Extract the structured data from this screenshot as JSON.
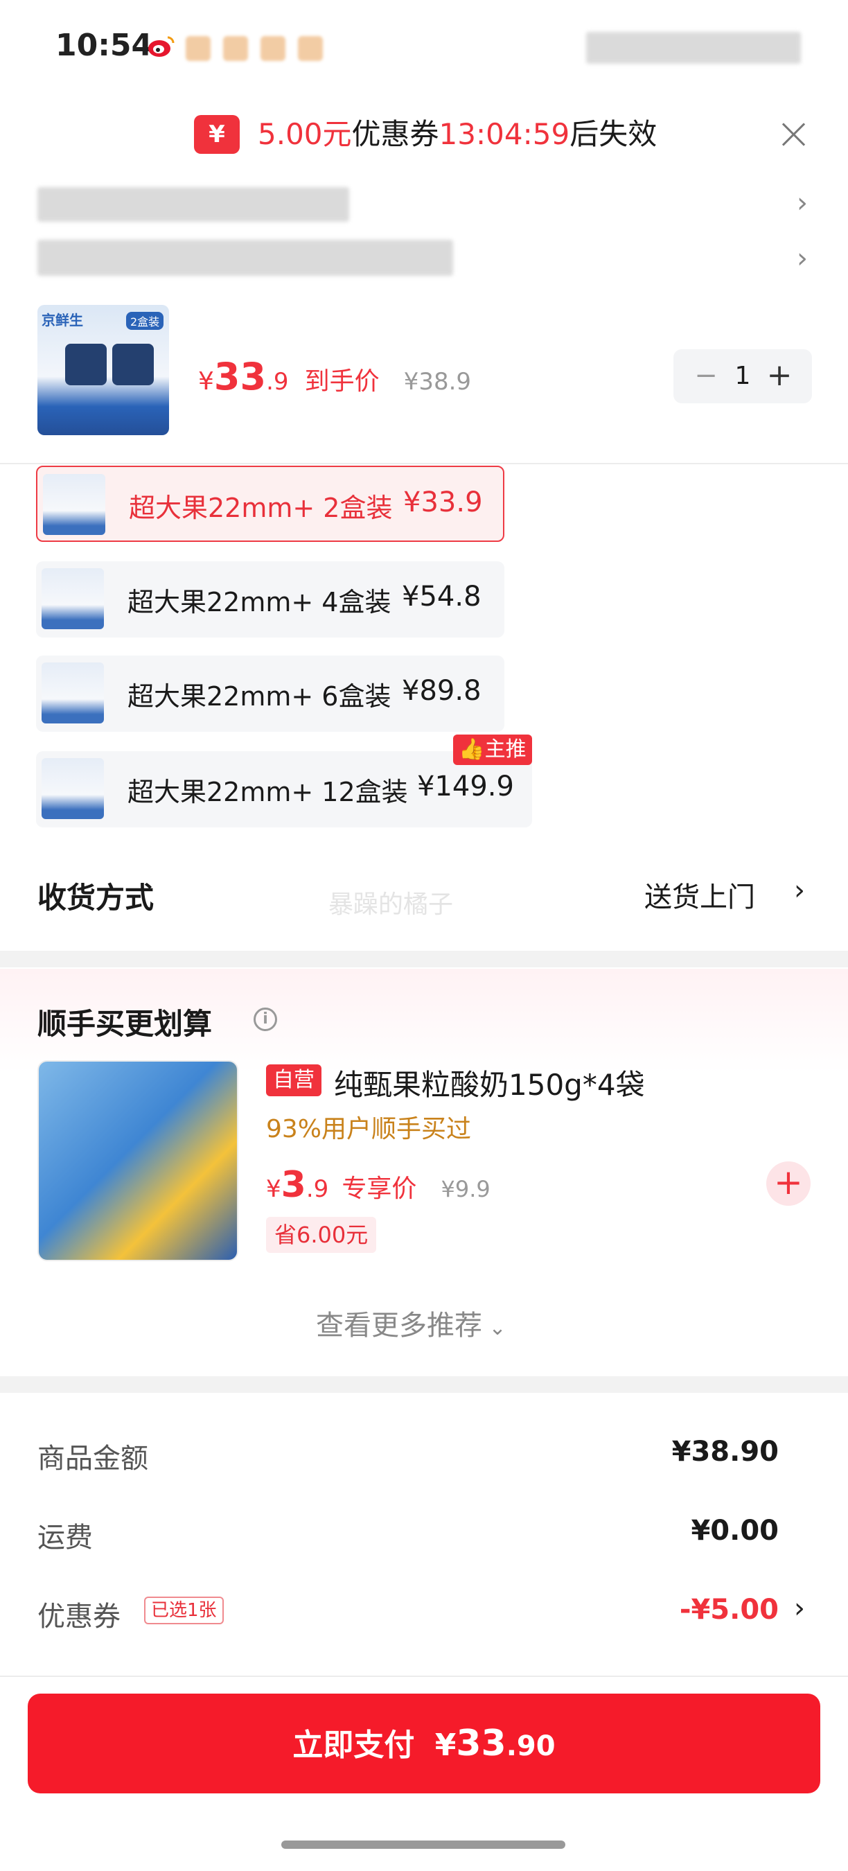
{
  "status_bar": {
    "time": "10:54"
  },
  "coupon_banner": {
    "icon": "¥",
    "amount": "5.00元",
    "label": "优惠券",
    "countdown": "13:04:59",
    "suffix": "后失效"
  },
  "product": {
    "price_symbol": "¥",
    "price_int": "33",
    "price_dec": ".9",
    "price_label": "到手价",
    "original_price": "¥38.9",
    "quantity": "1",
    "thumb_brand": "京鲜生",
    "thumb_badge": "2盒装"
  },
  "variants": [
    {
      "label": "超大果22mm+ 2盒装",
      "price": "¥33.9",
      "selected": true
    },
    {
      "label": "超大果22mm+ 4盒装",
      "price": "¥54.8",
      "selected": false
    },
    {
      "label": "超大果22mm+ 6盒装",
      "price": "¥89.8",
      "selected": false
    },
    {
      "label": "超大果22mm+ 12盒装",
      "price": "¥149.9",
      "selected": false,
      "tag": "主推"
    }
  ],
  "delivery": {
    "title": "收货方式",
    "watermark": "暴躁的橘子",
    "value": "送货上门"
  },
  "recommend": {
    "title": "顺手买更划算",
    "item": {
      "tag": "自营",
      "name": "纯甄果粒酸奶150g*4袋",
      "buy_rate": "93%用户顺手买过",
      "price_symbol": "¥",
      "price_int": "3",
      "price_dec": ".9",
      "price_label": "专享价",
      "original_price": "¥9.9",
      "saving": "省6.00元"
    },
    "more": "查看更多推荐"
  },
  "summary": {
    "goods_label": "商品金额",
    "goods_value": "¥38.90",
    "shipping_label": "运费",
    "shipping_value": "¥0.00",
    "coupon_label": "优惠券",
    "coupon_chip": "已选1张",
    "coupon_value": "-¥5.00"
  },
  "pay_button": {
    "label": "立即支付",
    "symbol": "¥",
    "int": "33",
    "dec": ".90"
  },
  "colors": {
    "accent": "#f0323c",
    "pay": "#f51b2a",
    "gold": "#c9821b"
  }
}
